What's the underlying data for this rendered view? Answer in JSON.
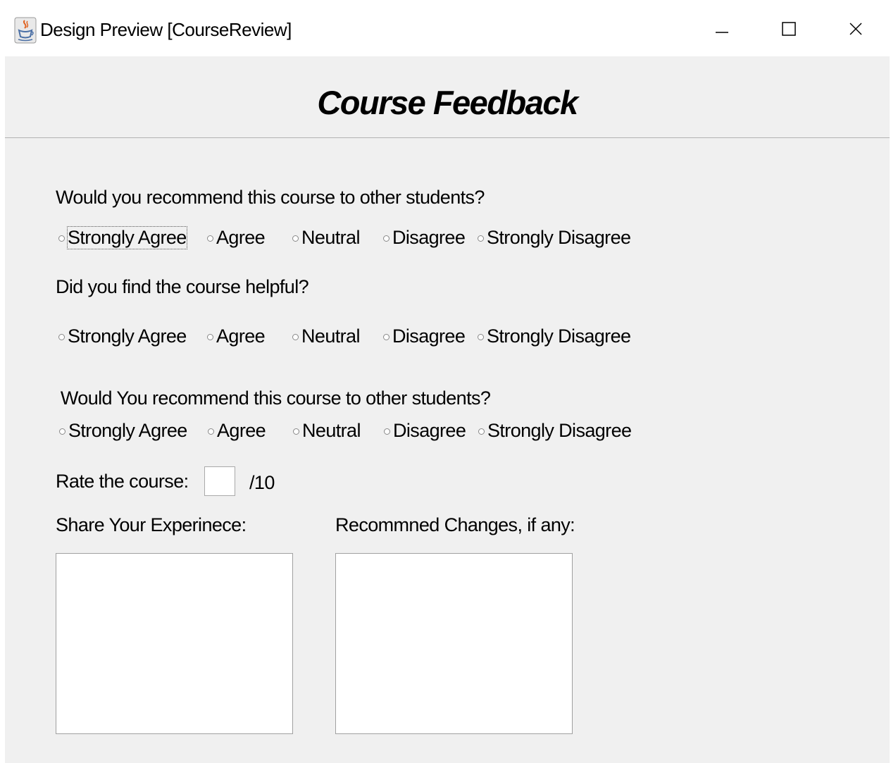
{
  "window": {
    "title": "Design Preview [CourseReview]",
    "controls": {
      "minimize": "–",
      "maximize": "☐",
      "close": "X"
    }
  },
  "form": {
    "heading": "Course Feedback",
    "questions": [
      {
        "text": "Would you recommend this course to other students?"
      },
      {
        "text": "Did you find the course helpful?"
      },
      {
        "text": " Would You recommend this course to other students?"
      }
    ],
    "options": [
      "Strongly Agree",
      "Agree",
      "Neutral",
      "Disagree",
      "Strongly Disagree"
    ],
    "focused_option": "Strongly Agree",
    "rate": {
      "label": "Rate the course:",
      "value": "",
      "suffix": "/10"
    },
    "experience_label": "Share Your Experinece:",
    "changes_label": "Recommned Changes, if any:"
  },
  "icons": {
    "app": "java-coffee-cup-icon"
  }
}
